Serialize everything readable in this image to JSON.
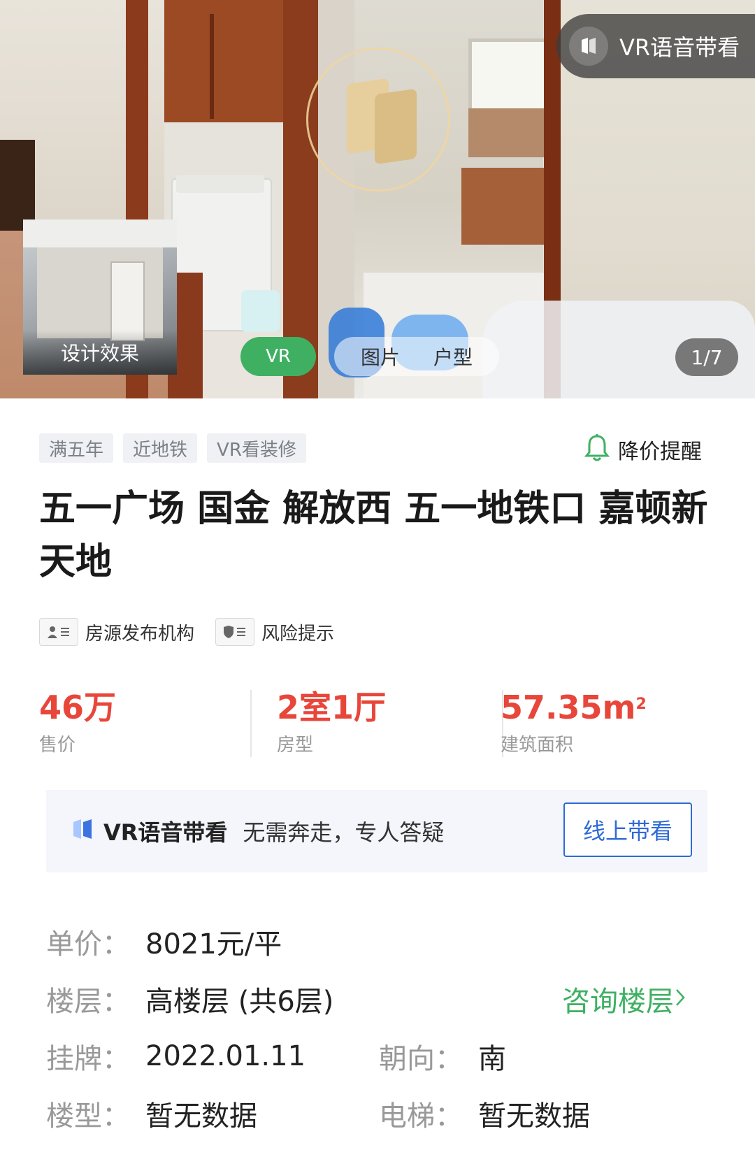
{
  "hero": {
    "vr_voice_badge": "VR语音带看",
    "design_label": "设计效果",
    "tabs": [
      "VR",
      "图片",
      "户型"
    ],
    "counter": "1/7"
  },
  "listing": {
    "tags": [
      "满五年",
      "近地铁",
      "VR看装修"
    ],
    "price_alert": "降价提醒",
    "title": "五一广场  国金 解放西 五一地铁口 嘉顿新天地",
    "meta": [
      "房源发布机构",
      "风险提示"
    ],
    "stats": [
      {
        "value": "46万",
        "caption": "售价"
      },
      {
        "value": "2室1厅",
        "caption": "房型"
      },
      {
        "value": "57.35m",
        "unit_sup": "2",
        "caption": "建筑面积"
      }
    ]
  },
  "vr_banner": {
    "name": "VR语音带看",
    "subtitle": "无需奔走，专人答疑",
    "button": "线上带看"
  },
  "details": {
    "unit_price": {
      "key": "单价：",
      "value": "8021元/平"
    },
    "floor": {
      "key": "楼层：",
      "value": "高楼层 (共6层)",
      "action": "咨询楼层"
    },
    "listed": {
      "key": "挂牌：",
      "value": "2022.01.11"
    },
    "orientation": {
      "key": "朝向：",
      "value": "南"
    },
    "building_type": {
      "key": "楼型：",
      "value": "暂无数据"
    },
    "elevator": {
      "key": "电梯：",
      "value": "暂无数据"
    }
  },
  "colors": {
    "accent_green": "#3fb062",
    "price_red": "#e8463a",
    "link_blue": "#2f6ad6"
  }
}
